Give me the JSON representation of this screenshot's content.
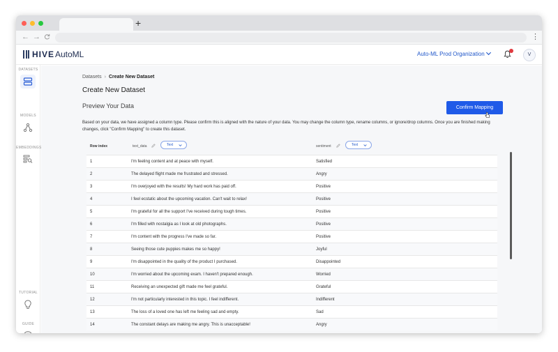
{
  "browser": {
    "new_tab_glyph": "+",
    "back_glyph": "←",
    "forward_glyph": "→",
    "reload_glyph": "C",
    "menu_glyph": "⋮",
    "traffic_lights": [
      "#fe5f57",
      "#febc2e",
      "#28c840"
    ]
  },
  "header": {
    "logo_bold": "HIVE",
    "logo_light": "AutoML",
    "organization": "Auto-ML Prod Organization",
    "avatar_initial": "V"
  },
  "sidebar": {
    "sections": [
      {
        "label": "DATASETS",
        "icon": "database-icon",
        "active": true
      },
      {
        "label": "MODELS",
        "icon": "network-icon",
        "active": false
      },
      {
        "label": "EMBEDDINGS",
        "icon": "embedding-search-icon",
        "active": false
      },
      {
        "label": "TUTORIAL",
        "icon": "lightbulb-icon",
        "active": false
      },
      {
        "label": "GUIDE",
        "icon": "help-circle-icon",
        "active": false
      }
    ]
  },
  "breadcrumb": {
    "parent": "Datasets",
    "separator": "›",
    "current": "Create New Dataset"
  },
  "page": {
    "title": "Create New Dataset",
    "preview_title": "Preview Your Data",
    "confirm_label": "Confirm Mapping",
    "description": "Based on your data, we have assigned a column type. Please confirm this is aligned with the nature of your data. You may change the column type, rename columns, or ignore/drop columns. Once you are finished making changes, click \"Confirm Mapping\" to create this dataset."
  },
  "table": {
    "columns": {
      "row_index": "Row index",
      "text_data": "text_data",
      "text_data_type": "Text",
      "sentiment": "sentiment",
      "sentiment_type": "Text"
    },
    "rows": [
      {
        "index": "1",
        "text": "I'm feeling content and at peace with myself.",
        "sentiment": "Satisfied"
      },
      {
        "index": "2",
        "text": "The delayed flight made me frustrated and stressed.",
        "sentiment": "Angry"
      },
      {
        "index": "3",
        "text": "I'm overjoyed with the results! My hard work has paid off.",
        "sentiment": "Positive"
      },
      {
        "index": "4",
        "text": "I feel ecstatic about the upcoming vacation. Can't wait to relax!",
        "sentiment": "Positive"
      },
      {
        "index": "5",
        "text": "I'm grateful for all the support I've received during tough times.",
        "sentiment": "Positive"
      },
      {
        "index": "6",
        "text": "I'm filled with nostalgia as I look at old photographs.",
        "sentiment": "Positive"
      },
      {
        "index": "7",
        "text": "I'm content with the progress I've made so far.",
        "sentiment": "Positive"
      },
      {
        "index": "8",
        "text": "Seeing those cute puppies makes me so happy!",
        "sentiment": "Joyful"
      },
      {
        "index": "9",
        "text": "I'm disappointed in the quality of the product I purchased.",
        "sentiment": "Disappointed"
      },
      {
        "index": "10",
        "text": "I'm worried about the upcoming exam. I haven't prepared enough.",
        "sentiment": "Worried"
      },
      {
        "index": "11",
        "text": "Receiving an unexpected gift made me feel grateful.",
        "sentiment": "Grateful"
      },
      {
        "index": "12",
        "text": "I'm not particularly interested in this topic. I feel indifferent.",
        "sentiment": "Indifferent"
      },
      {
        "index": "13",
        "text": "The loss of a loved one has left me feeling sad and empty.",
        "sentiment": "Sad"
      },
      {
        "index": "14",
        "text": "The constant delays are making me angry. This is unacceptable!",
        "sentiment": "Angry"
      }
    ]
  },
  "colors": {
    "primary": "#1f5ae8",
    "brand_navy": "#1d2b4f",
    "notification": "#e0393e"
  }
}
